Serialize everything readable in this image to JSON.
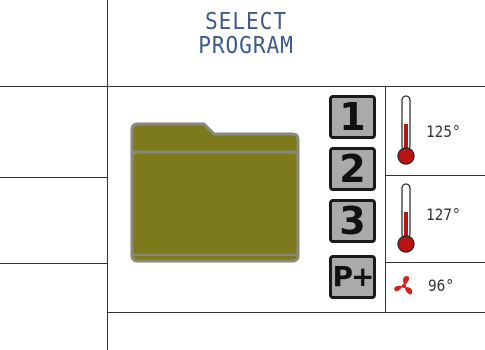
{
  "header": {
    "title_line1": "SELECT",
    "title_line2": "PROGRAM"
  },
  "programs": [
    {
      "label": "1"
    },
    {
      "label": "2"
    },
    {
      "label": "3"
    },
    {
      "label": "P+"
    }
  ],
  "readouts": [
    {
      "icon": "thermometer-icon",
      "value": "125°"
    },
    {
      "icon": "thermometer-icon",
      "value": "127°"
    },
    {
      "icon": "fan-icon",
      "value": "96°"
    }
  ],
  "colors": {
    "title": "#3d5a8c",
    "folder_fill": "#7d7a1c",
    "folder_stroke": "#8a8a7a",
    "button_fill": "#aaaaaa",
    "thermometer_red": "#b81414",
    "fan_red": "#d62020"
  }
}
